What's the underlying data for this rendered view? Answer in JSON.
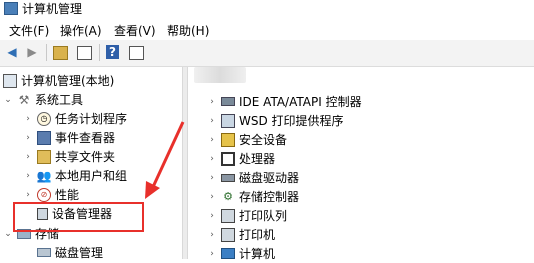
{
  "window": {
    "title": "计算机管理"
  },
  "menu": {
    "file": "文件(F)",
    "action": "操作(A)",
    "view": "查看(V)",
    "help": "帮助(H)"
  },
  "tree": {
    "root": "计算机管理(本地)",
    "system_tools": "系统工具",
    "task_scheduler": "任务计划程序",
    "event_viewer": "事件查看器",
    "shared_folders": "共享文件夹",
    "local_users": "本地用户和组",
    "performance": "性能",
    "device_manager": "设备管理器",
    "storage": "存储",
    "disk_management": "磁盘管理"
  },
  "devices": [
    {
      "label": "IDE ATA/ATAPI 控制器",
      "icon": "ide-controller-icon"
    },
    {
      "label": "WSD 打印提供程序",
      "icon": "wsd-printer-icon"
    },
    {
      "label": "安全设备",
      "icon": "security-device-icon"
    },
    {
      "label": "处理器",
      "icon": "processor-icon"
    },
    {
      "label": "磁盘驱动器",
      "icon": "disk-drive-icon"
    },
    {
      "label": "存储控制器",
      "icon": "storage-controller-icon"
    },
    {
      "label": "打印队列",
      "icon": "print-queue-icon"
    },
    {
      "label": "打印机",
      "icon": "printer-icon"
    },
    {
      "label": "计算机",
      "icon": "computer-icon"
    }
  ],
  "colors": {
    "annotation": "#e8302b",
    "toolbar": "#f3f3f3"
  }
}
